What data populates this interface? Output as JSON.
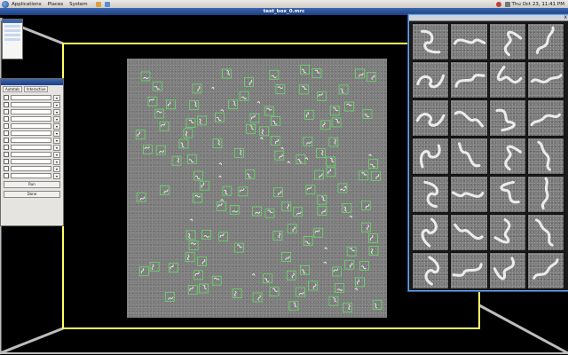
{
  "panel": {
    "menus": [
      "Applications",
      "Places",
      "System"
    ],
    "clock": "Thu Oct 23, 11:41 PM"
  },
  "window": {
    "title": "test_box_0.mrc"
  },
  "micrograph": {
    "box_count": 118,
    "colors": {
      "frame": "#ffff66",
      "box": "#66dd66",
      "background": "#808080"
    }
  },
  "controls": {
    "tabs": [
      "Autotab",
      "Interactive"
    ],
    "rows": [
      {
        "label": "Boxsize",
        "value": ""
      },
      {
        "label": "Erase",
        "value": ""
      },
      {
        "label": "Thresh",
        "value": ""
      },
      {
        "label": "Cutoff",
        "value": ""
      },
      {
        "label": "Particles",
        "value": ""
      },
      {
        "label": "Spacing",
        "value": ""
      },
      {
        "label": "Pick",
        "value": ""
      },
      {
        "label": "Refine",
        "value": ""
      },
      {
        "label": "Display",
        "value": ""
      },
      {
        "label": "Mode",
        "value": ""
      },
      {
        "label": "Scale",
        "value": ""
      },
      {
        "label": "Boxes",
        "value": ""
      }
    ],
    "buttons": [
      "Run",
      "Done"
    ]
  },
  "gallery": {
    "rows": 7,
    "cols": 4,
    "close_label": "x"
  }
}
